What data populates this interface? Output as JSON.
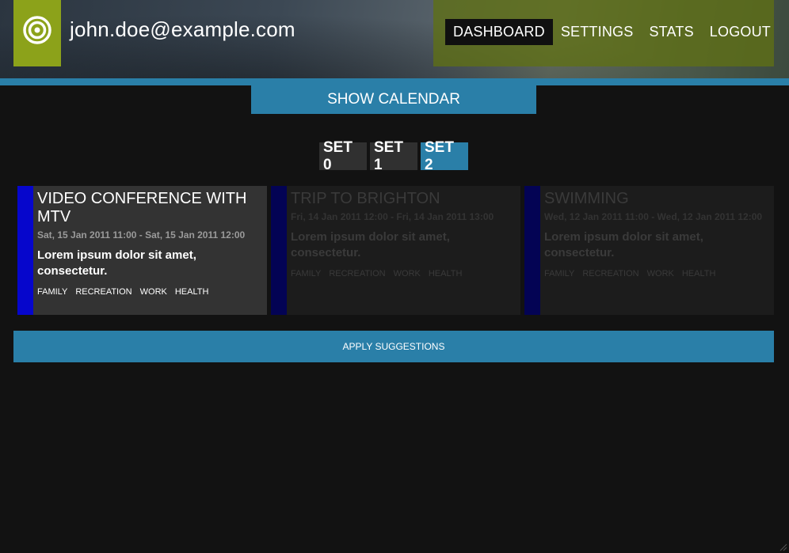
{
  "header": {
    "user_email": "john.doe@example.com",
    "logo_icon": "target-icon"
  },
  "nav": {
    "items": [
      {
        "label": "DASHBOARD",
        "active": true
      },
      {
        "label": "SETTINGS",
        "active": false
      },
      {
        "label": "STATS",
        "active": false
      },
      {
        "label": "LOGOUT",
        "active": false
      }
    ]
  },
  "calendar": {
    "show_label": "SHOW CALENDAR"
  },
  "sets": {
    "tabs": [
      {
        "label": "SET 0",
        "active": false
      },
      {
        "label": "SET 1",
        "active": false
      },
      {
        "label": "SET 2",
        "active": true
      }
    ]
  },
  "events": [
    {
      "title": "VIDEO CONFERENCE WITH MTV",
      "date": "Sat, 15 Jan 2011 11:00 - Sat, 15 Jan 2011 12:00",
      "description": "Lorem ipsum dolor sit amet, consectetur.",
      "tags": [
        "FAMILY",
        "RECREATION",
        "WORK",
        "HEALTH"
      ],
      "selected": true
    },
    {
      "title": "TRIP TO BRIGHTON",
      "date": "Fri, 14 Jan 2011 12:00 - Fri, 14 Jan 2011 13:00",
      "description": "Lorem ipsum dolor sit amet, consectetur.",
      "tags": [
        "FAMILY",
        "RECREATION",
        "WORK",
        "HEALTH"
      ],
      "selected": false
    },
    {
      "title": "SWIMMING",
      "date": "Wed, 12 Jan 2011 11:00 - Wed, 12 Jan 2011 12:00",
      "description": "Lorem ipsum dolor sit amet, consectetur.",
      "tags": [
        "FAMILY",
        "RECREATION",
        "WORK",
        "HEALTH"
      ],
      "selected": false
    }
  ],
  "actions": {
    "apply_label": "APPLY SUGGESTIONS"
  },
  "colors": {
    "accent_blue": "#2a7fa8",
    "logo_green": "#8ca21a",
    "nav_green": "#5f7014",
    "event_bar": "#0606cc",
    "background": "#121212"
  }
}
